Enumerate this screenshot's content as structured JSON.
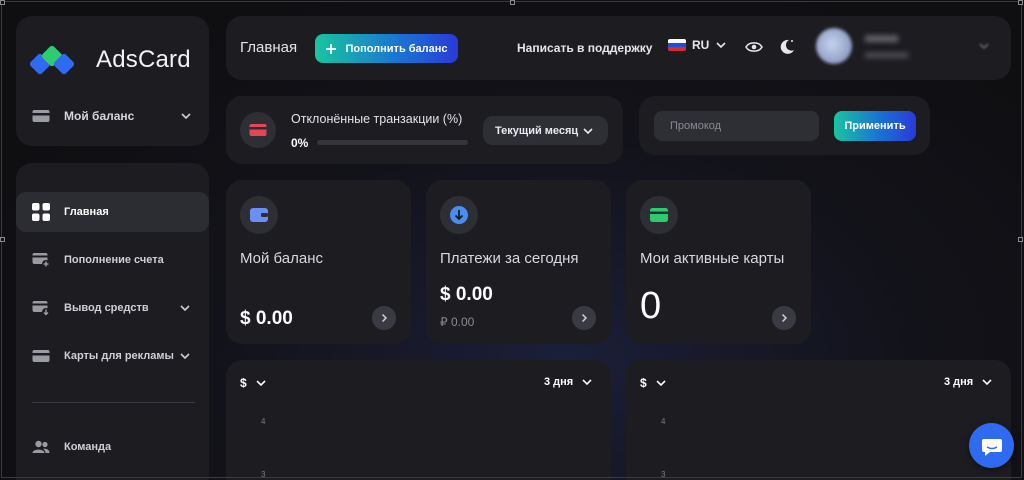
{
  "app": {
    "name": "AdsCard"
  },
  "sidebar": {
    "balance_label": "Мой баланс",
    "items": [
      {
        "label": "Главная",
        "icon": "grid-icon",
        "active": true
      },
      {
        "label": "Пополнение счета",
        "icon": "card-plus-icon"
      },
      {
        "label": "Вывод средств",
        "icon": "card-withdraw-icon"
      },
      {
        "label": "Карты для рекламы",
        "icon": "card-icon"
      },
      {
        "label": "Команда",
        "icon": "team-icon"
      }
    ]
  },
  "header": {
    "title": "Главная",
    "topup_label": "Пополнить баланс",
    "support_label": "Написать в поддержку",
    "language": "RU"
  },
  "rejected": {
    "title": "Отклонённые транзакции (%)",
    "value": "0%",
    "progress": 0,
    "period_label": "Текущий месяц"
  },
  "promo": {
    "placeholder": "Промокод",
    "apply_label": "Применить"
  },
  "stats": {
    "balance": {
      "label": "Мой баланс",
      "value": "$ 0.00"
    },
    "today": {
      "label": "Платежи за сегодня",
      "value": "$ 0.00",
      "sub": "₽ 0.00"
    },
    "cards": {
      "label": "Мои активные карты",
      "value": "0"
    }
  },
  "charts": [
    {
      "currency": "$",
      "range": "3 дня",
      "ticks": [
        "4",
        "3"
      ]
    },
    {
      "currency": "$",
      "range": "3 дня",
      "ticks": [
        "4",
        "3"
      ]
    }
  ],
  "colors": {
    "accent_gradient_start": "#19c4a0",
    "accent_gradient_end": "#2a3ad8",
    "danger": "#e2465a",
    "income": "#4a8df0",
    "cards": "#2ecc71",
    "chat": "#2f6bf0"
  }
}
